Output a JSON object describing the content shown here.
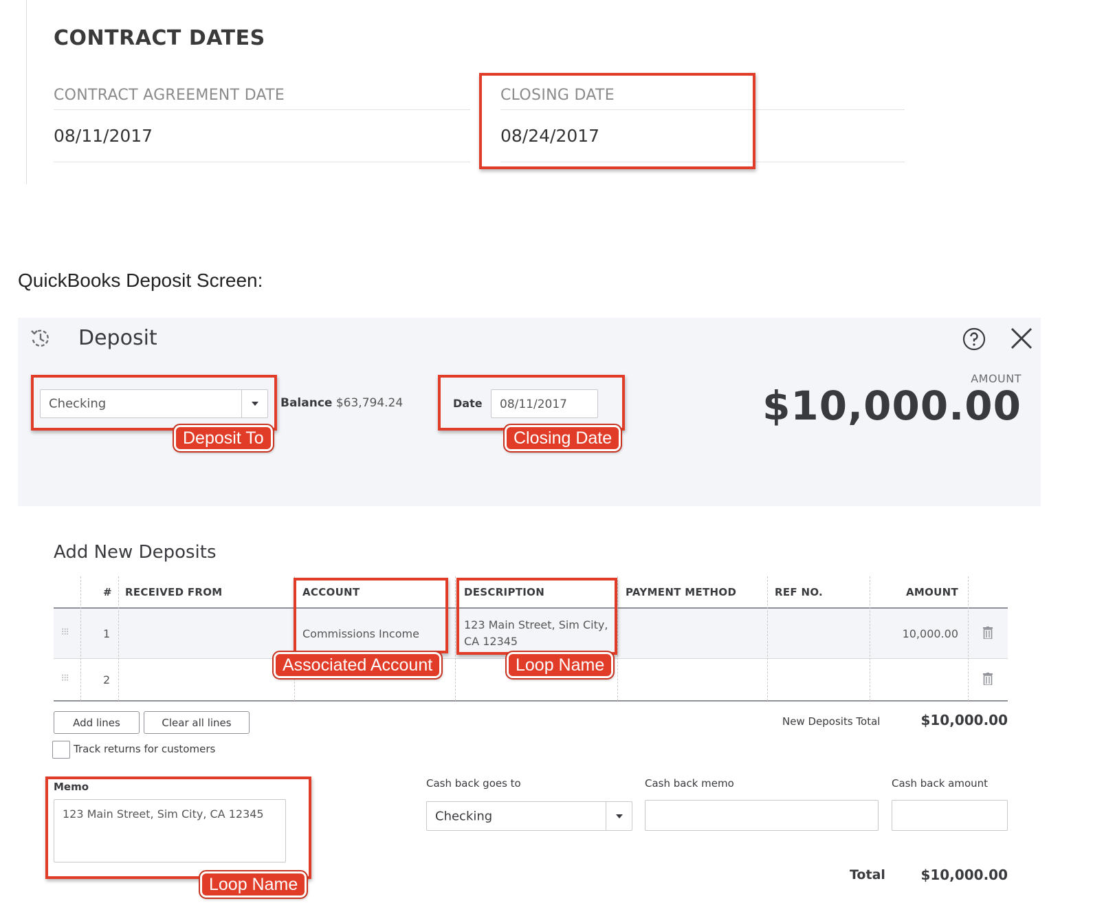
{
  "contract_dates": {
    "title": "CONTRACT DATES",
    "agreement_label": "CONTRACT AGREEMENT DATE",
    "agreement_value": "08/11/2017",
    "closing_label": "CLOSING DATE",
    "closing_value": "08/24/2017"
  },
  "caption": "QuickBooks Deposit Screen:",
  "deposit": {
    "title": "Deposit",
    "account_select": "Checking",
    "balance_label": "Balance",
    "balance_value": "$63,794.24",
    "date_label": "Date",
    "date_value": "08/11/2017",
    "amount_label": "AMOUNT",
    "amount_value": "$10,000.00"
  },
  "annotations": {
    "deposit_to": "Deposit To",
    "closing_date": "Closing Date",
    "associated_account": "Associated Account",
    "loop_name": "Loop Name",
    "loop_name_memo": "Loop Name"
  },
  "table": {
    "section_title": "Add New Deposits",
    "headers": {
      "num": "#",
      "received_from": "RECEIVED FROM",
      "account": "ACCOUNT",
      "description": "DESCRIPTION",
      "payment_method": "PAYMENT METHOD",
      "ref_no": "REF NO.",
      "amount": "AMOUNT"
    },
    "rows": [
      {
        "num": "1",
        "received_from": "",
        "account": "Commissions Income",
        "description_line1": "123 Main Street, Sim City,",
        "description_line2": "CA 12345",
        "payment_method": "",
        "ref_no": "",
        "amount": "10,000.00"
      },
      {
        "num": "2",
        "received_from": "",
        "account": "",
        "description_line1": "",
        "description_line2": "",
        "payment_method": "",
        "ref_no": "",
        "amount": ""
      }
    ]
  },
  "footer": {
    "add_lines": "Add lines",
    "clear_all_lines": "Clear all lines",
    "track_returns": "Track returns for customers",
    "new_deposits_total_label": "New Deposits Total",
    "new_deposits_total_value": "$10,000.00",
    "memo_label": "Memo",
    "memo_value": "123 Main Street, Sim City, CA 12345",
    "cash_back_goes_to_label": "Cash back goes to",
    "cash_back_goes_to_value": "Checking",
    "cash_back_memo_label": "Cash back memo",
    "cash_back_amount_label": "Cash back amount",
    "total_label": "Total",
    "total_value": "$10,000.00"
  },
  "icons": {
    "history": "history-icon",
    "help": "help-icon",
    "close": "close-icon",
    "drag": "drag-handle-icon",
    "trash": "trash-icon",
    "dropdown": "chevron-down-icon"
  },
  "colors": {
    "annotation_red": "#e03c27",
    "header_bg": "#f4f5f8",
    "text": "#393a3d"
  }
}
